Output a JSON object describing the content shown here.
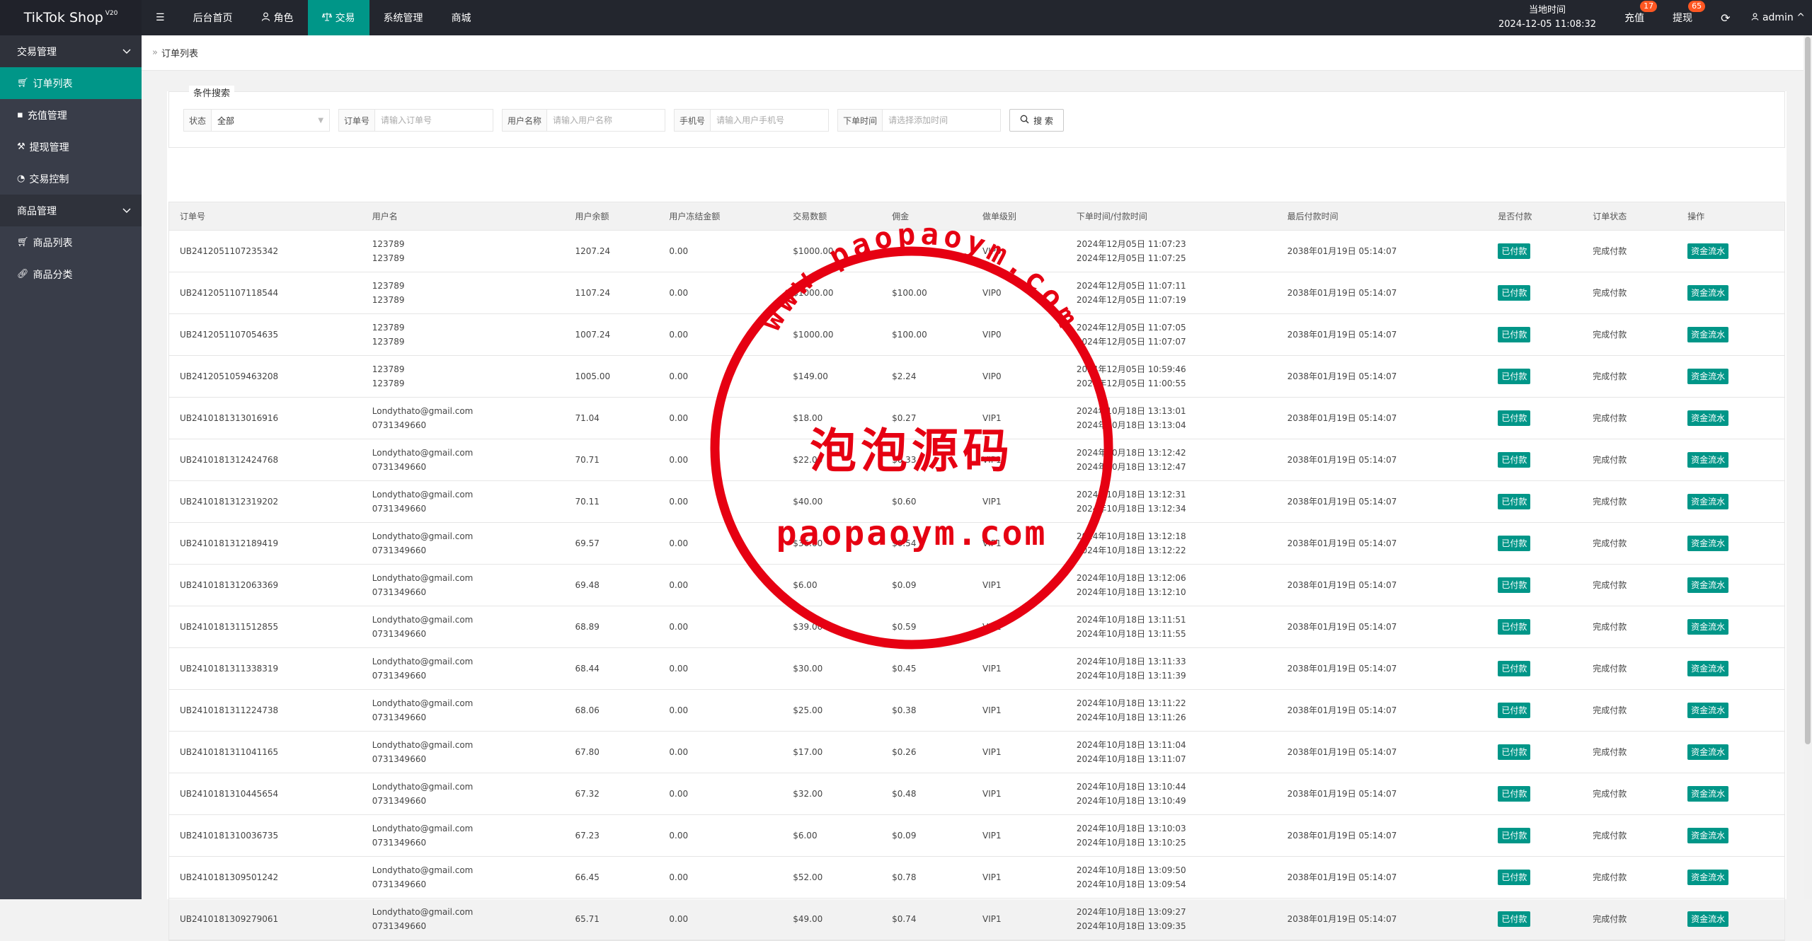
{
  "app": {
    "title": "TikTok Shop",
    "version": "V20"
  },
  "topnav": [
    {
      "label": "后台首页",
      "icon": ""
    },
    {
      "label": "角色",
      "icon": "user-icon"
    },
    {
      "label": "交易",
      "icon": "scale-icon"
    },
    {
      "label": "系统管理",
      "icon": ""
    },
    {
      "label": "商城",
      "icon": ""
    }
  ],
  "header": {
    "time_label": "当地时间",
    "time_value": "2024-12-05 11:08:32",
    "recharge_label": "充值",
    "recharge_badge": "17",
    "withdraw_label": "提现",
    "withdraw_badge": "65",
    "user": "admin"
  },
  "sidebar": {
    "groups": [
      {
        "label": "交易管理",
        "items": [
          {
            "label": "订单列表",
            "icon": "cart-icon"
          },
          {
            "label": "充值管理",
            "icon": "comment-icon"
          },
          {
            "label": "提现管理",
            "icon": "hammer-icon"
          },
          {
            "label": "交易控制",
            "icon": "dashboard-icon"
          }
        ]
      },
      {
        "label": "商品管理",
        "items": [
          {
            "label": "商品列表",
            "icon": "cart-icon"
          },
          {
            "label": "商品分类",
            "icon": "link-icon"
          }
        ]
      }
    ]
  },
  "breadcrumb": "订单列表",
  "search": {
    "legend": "条件搜索",
    "status_label": "状态",
    "status_value": "全部",
    "order_label": "订单号",
    "order_placeholder": "请输入订单号",
    "username_label": "用户名称",
    "username_placeholder": "请输入用户名称",
    "phone_label": "手机号",
    "phone_placeholder": "请输入用户手机号",
    "time_label": "下单时间",
    "time_placeholder": "请选择添加时间",
    "button": "搜 索"
  },
  "table": {
    "headers": [
      "订单号",
      "用户名",
      "用户余额",
      "用户冻结金额",
      "交易数额",
      "佣金",
      "做单级别",
      "下单时间/付款时间",
      "最后付款时间",
      "是否付款",
      "订单状态",
      "操作"
    ],
    "rows": [
      {
        "id": "UB2412051107235342",
        "user": "123789",
        "phone": "123789",
        "balance": "1207.24",
        "frozen": "0.00",
        "amount": "$1000.00",
        "commission": "$100.00",
        "level": "VIP0",
        "t1": "2024年12月05日 11:07:23",
        "t2": "2024年12月05日 11:07:25",
        "last": "2038年01月19日 05:14:07",
        "paid": "已付款",
        "status": "完成付款",
        "action": "资金流水"
      },
      {
        "id": "UB2412051107118544",
        "user": "123789",
        "phone": "123789",
        "balance": "1107.24",
        "frozen": "0.00",
        "amount": "$1000.00",
        "commission": "$100.00",
        "level": "VIP0",
        "t1": "2024年12月05日 11:07:11",
        "t2": "2024年12月05日 11:07:19",
        "last": "2038年01月19日 05:14:07",
        "paid": "已付款",
        "status": "完成付款",
        "action": "资金流水"
      },
      {
        "id": "UB2412051107054635",
        "user": "123789",
        "phone": "123789",
        "balance": "1007.24",
        "frozen": "0.00",
        "amount": "$1000.00",
        "commission": "$100.00",
        "level": "VIP0",
        "t1": "2024年12月05日 11:07:05",
        "t2": "2024年12月05日 11:07:07",
        "last": "2038年01月19日 05:14:07",
        "paid": "已付款",
        "status": "完成付款",
        "action": "资金流水"
      },
      {
        "id": "UB2412051059463208",
        "user": "123789",
        "phone": "123789",
        "balance": "1005.00",
        "frozen": "0.00",
        "amount": "$149.00",
        "commission": "$2.24",
        "level": "VIP0",
        "t1": "2024年12月05日 10:59:46",
        "t2": "2024年12月05日 11:00:55",
        "last": "2038年01月19日 05:14:07",
        "paid": "已付款",
        "status": "完成付款",
        "action": "资金流水"
      },
      {
        "id": "UB2410181313016916",
        "user": "Londythato@gmail.com",
        "phone": "0731349660",
        "balance": "71.04",
        "frozen": "0.00",
        "amount": "$18.00",
        "commission": "$0.27",
        "level": "VIP1",
        "t1": "2024年10月18日 13:13:01",
        "t2": "2024年10月18日 13:13:04",
        "last": "2038年01月19日 05:14:07",
        "paid": "已付款",
        "status": "完成付款",
        "action": "资金流水"
      },
      {
        "id": "UB2410181312424768",
        "user": "Londythato@gmail.com",
        "phone": "0731349660",
        "balance": "70.71",
        "frozen": "0.00",
        "amount": "$22.00",
        "commission": "$0.33",
        "level": "VIP1",
        "t1": "2024年10月18日 13:12:42",
        "t2": "2024年10月18日 13:12:47",
        "last": "2038年01月19日 05:14:07",
        "paid": "已付款",
        "status": "完成付款",
        "action": "资金流水"
      },
      {
        "id": "UB2410181312319202",
        "user": "Londythato@gmail.com",
        "phone": "0731349660",
        "balance": "70.11",
        "frozen": "0.00",
        "amount": "$40.00",
        "commission": "$0.60",
        "level": "VIP1",
        "t1": "2024年10月18日 13:12:31",
        "t2": "2024年10月18日 13:12:34",
        "last": "2038年01月19日 05:14:07",
        "paid": "已付款",
        "status": "完成付款",
        "action": "资金流水"
      },
      {
        "id": "UB2410181312189419",
        "user": "Londythato@gmail.com",
        "phone": "0731349660",
        "balance": "69.57",
        "frozen": "0.00",
        "amount": "$36.00",
        "commission": "$0.54",
        "level": "VIP1",
        "t1": "2024年10月18日 13:12:18",
        "t2": "2024年10月18日 13:12:22",
        "last": "2038年01月19日 05:14:07",
        "paid": "已付款",
        "status": "完成付款",
        "action": "资金流水"
      },
      {
        "id": "UB2410181312063369",
        "user": "Londythato@gmail.com",
        "phone": "0731349660",
        "balance": "69.48",
        "frozen": "0.00",
        "amount": "$6.00",
        "commission": "$0.09",
        "level": "VIP1",
        "t1": "2024年10月18日 13:12:06",
        "t2": "2024年10月18日 13:12:10",
        "last": "2038年01月19日 05:14:07",
        "paid": "已付款",
        "status": "完成付款",
        "action": "资金流水"
      },
      {
        "id": "UB2410181311512855",
        "user": "Londythato@gmail.com",
        "phone": "0731349660",
        "balance": "68.89",
        "frozen": "0.00",
        "amount": "$39.00",
        "commission": "$0.59",
        "level": "VIP1",
        "t1": "2024年10月18日 13:11:51",
        "t2": "2024年10月18日 13:11:55",
        "last": "2038年01月19日 05:14:07",
        "paid": "已付款",
        "status": "完成付款",
        "action": "资金流水"
      },
      {
        "id": "UB2410181311338319",
        "user": "Londythato@gmail.com",
        "phone": "0731349660",
        "balance": "68.44",
        "frozen": "0.00",
        "amount": "$30.00",
        "commission": "$0.45",
        "level": "VIP1",
        "t1": "2024年10月18日 13:11:33",
        "t2": "2024年10月18日 13:11:39",
        "last": "2038年01月19日 05:14:07",
        "paid": "已付款",
        "status": "完成付款",
        "action": "资金流水"
      },
      {
        "id": "UB2410181311224738",
        "user": "Londythato@gmail.com",
        "phone": "0731349660",
        "balance": "68.06",
        "frozen": "0.00",
        "amount": "$25.00",
        "commission": "$0.38",
        "level": "VIP1",
        "t1": "2024年10月18日 13:11:22",
        "t2": "2024年10月18日 13:11:26",
        "last": "2038年01月19日 05:14:07",
        "paid": "已付款",
        "status": "完成付款",
        "action": "资金流水"
      },
      {
        "id": "UB2410181311041165",
        "user": "Londythato@gmail.com",
        "phone": "0731349660",
        "balance": "67.80",
        "frozen": "0.00",
        "amount": "$17.00",
        "commission": "$0.26",
        "level": "VIP1",
        "t1": "2024年10月18日 13:11:04",
        "t2": "2024年10月18日 13:11:07",
        "last": "2038年01月19日 05:14:07",
        "paid": "已付款",
        "status": "完成付款",
        "action": "资金流水"
      },
      {
        "id": "UB2410181310445654",
        "user": "Londythato@gmail.com",
        "phone": "0731349660",
        "balance": "67.32",
        "frozen": "0.00",
        "amount": "$32.00",
        "commission": "$0.48",
        "level": "VIP1",
        "t1": "2024年10月18日 13:10:44",
        "t2": "2024年10月18日 13:10:49",
        "last": "2038年01月19日 05:14:07",
        "paid": "已付款",
        "status": "完成付款",
        "action": "资金流水"
      },
      {
        "id": "UB2410181310036735",
        "user": "Londythato@gmail.com",
        "phone": "0731349660",
        "balance": "67.23",
        "frozen": "0.00",
        "amount": "$6.00",
        "commission": "$0.09",
        "level": "VIP1",
        "t1": "2024年10月18日 13:10:03",
        "t2": "2024年10月18日 13:10:25",
        "last": "2038年01月19日 05:14:07",
        "paid": "已付款",
        "status": "完成付款",
        "action": "资金流水"
      },
      {
        "id": "UB2410181309501242",
        "user": "Londythato@gmail.com",
        "phone": "0731349660",
        "balance": "66.45",
        "frozen": "0.00",
        "amount": "$52.00",
        "commission": "$0.78",
        "level": "VIP1",
        "t1": "2024年10月18日 13:09:50",
        "t2": "2024年10月18日 13:09:54",
        "last": "2038年01月19日 05:14:07",
        "paid": "已付款",
        "status": "完成付款",
        "action": "资金流水"
      },
      {
        "id": "UB2410181309279061",
        "user": "Londythato@gmail.com",
        "phone": "0731349660",
        "balance": "65.71",
        "frozen": "0.00",
        "amount": "$49.00",
        "commission": "$0.74",
        "level": "VIP1",
        "t1": "2024年10月18日 13:09:27",
        "t2": "2024年10月18日 13:09:35",
        "last": "2038年01月19日 05:14:07",
        "paid": "已付款",
        "status": "完成付款",
        "action": "资金流水"
      }
    ]
  },
  "watermark": {
    "arc_text": "www.paopaoym.com",
    "center_text": "泡泡源码",
    "bottom_text": "paopaoym.com",
    "color": "#e60012"
  },
  "colors": {
    "accent": "#009688",
    "topbar": "#23262e",
    "sidebar": "#393d49",
    "badge": "#ff5722"
  }
}
